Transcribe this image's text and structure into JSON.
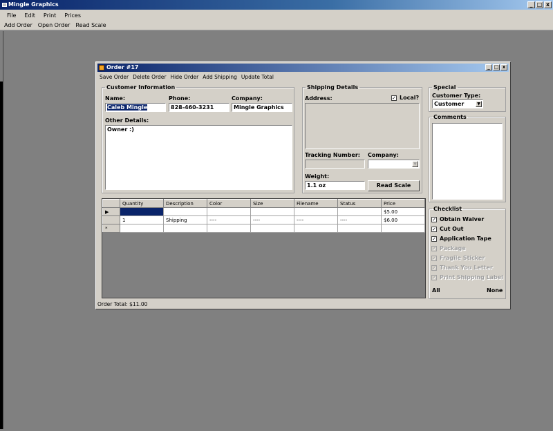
{
  "app": {
    "title": "Mingle Graphics",
    "window_buttons": [
      "_",
      "□",
      "x"
    ]
  },
  "menu": [
    "File",
    "Edit",
    "Print",
    "Prices"
  ],
  "toolbar": [
    "Add Order",
    "Open Order",
    "Read Scale"
  ],
  "order_window": {
    "title": "Order #17",
    "toolbar": [
      "Save Order",
      "Delete Order",
      "Hide Order",
      "Add Shipping",
      "Update Total"
    ],
    "customer": {
      "legend": "Customer Information",
      "name_label": "Name:",
      "name_value": "Caleb Mingle",
      "phone_label": "Phone:",
      "phone_value": "828-460-3231",
      "company_label": "Company:",
      "company_value": "Mingle Graphics",
      "details_label": "Other Details:",
      "details_value": "Owner :)"
    },
    "shipping": {
      "legend": "Shipping Details",
      "address_label": "Address:",
      "local_label": "Local?",
      "local_checked": true,
      "address_value": "",
      "tracking_label": "Tracking Number:",
      "tracking_value": "",
      "company_label": "Company:",
      "company_value": "",
      "weight_label": "Weight:",
      "weight_value": "1.1 oz",
      "read_scale_label": "Read Scale"
    },
    "special": {
      "legend": "Special",
      "customer_type_label": "Customer Type:",
      "customer_type_value": "Customer"
    },
    "comments": {
      "legend": "Comments",
      "value": ""
    },
    "grid": {
      "columns": [
        "Quantity",
        "Description",
        "Color",
        "Size",
        "Filename",
        "Status",
        "Price"
      ],
      "rows": [
        {
          "marker": "▶",
          "cells": [
            "",
            "",
            "",
            "",
            "",
            "",
            "$5.00"
          ]
        },
        {
          "marker": "",
          "cells": [
            "1",
            "Shipping",
            "----",
            "----",
            "----",
            "----",
            "$6.00"
          ]
        },
        {
          "marker": "*",
          "cells": [
            "",
            "",
            "",
            "",
            "",
            "",
            ""
          ]
        }
      ]
    },
    "checklist": {
      "legend": "Checklist",
      "items": [
        {
          "label": "Obtain Waiver",
          "checked": true,
          "enabled": true
        },
        {
          "label": "Cut Out",
          "checked": true,
          "enabled": true
        },
        {
          "label": "Application Tape",
          "checked": true,
          "enabled": true
        },
        {
          "label": "Package",
          "checked": true,
          "enabled": false
        },
        {
          "label": "Fragile Sticker",
          "checked": true,
          "enabled": false
        },
        {
          "label": "Thank You Letter",
          "checked": true,
          "enabled": false
        },
        {
          "label": "Print Shipping Label",
          "checked": true,
          "enabled": false
        }
      ],
      "all_label": "All",
      "none_label": "None"
    },
    "status_text": "Order Total: $11.00"
  }
}
